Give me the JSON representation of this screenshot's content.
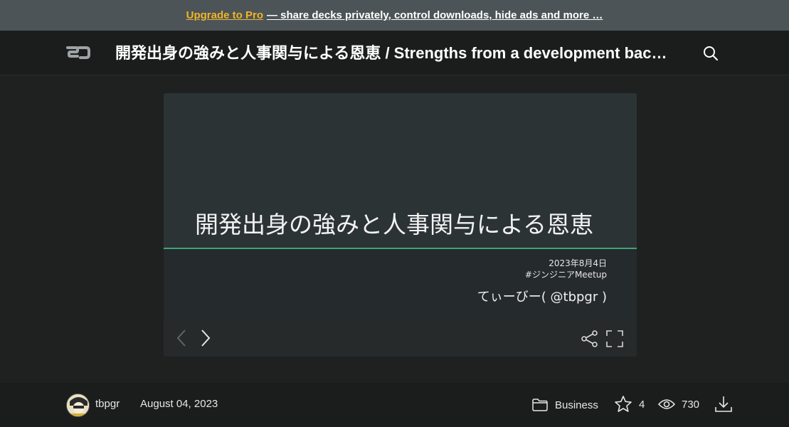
{
  "promo": {
    "link": "Upgrade to Pro",
    "rest": "— share decks privately, control downloads, hide ads and more …"
  },
  "header": {
    "logo_icon": "speakerdeck-logo",
    "title": "開発出身の強みと人事関与による恩恵 / Strengths from a development background and benefits from human resources involvement",
    "search_icon": "search-icon"
  },
  "slide": {
    "heading": "開発出身の強みと人事関与による恩恵",
    "date": "2023年8月4日",
    "tag": "#ジンジニアMeetup",
    "author": "てぃーびー( @tbpgr )"
  },
  "player_controls": {
    "prev_icon": "chevron-left-icon",
    "next_icon": "chevron-right-icon",
    "share_icon": "share-icon",
    "fullscreen_icon": "fullscreen-icon"
  },
  "footer": {
    "username": "tbpgr",
    "date": "August 04, 2023",
    "category": "Business",
    "stars": "4",
    "views": "730"
  },
  "colors": {
    "accent_orange": "#f0b429",
    "slide_rule_green": "#3fa37a",
    "background": "#1f2121"
  }
}
